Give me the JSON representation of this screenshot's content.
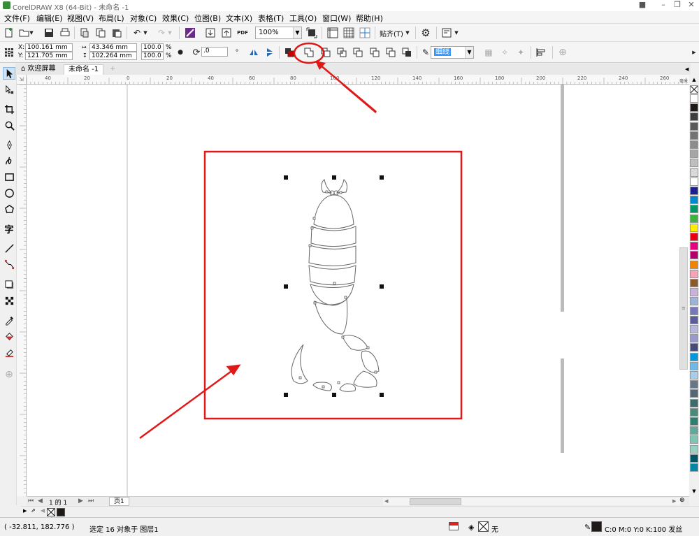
{
  "window": {
    "title": "CorelDRAW X8 (64-Bit) - 未命名 -1"
  },
  "menu": [
    "文件(F)",
    "编辑(E)",
    "视图(V)",
    "布局(L)",
    "对象(C)",
    "效果(C)",
    "位图(B)",
    "文本(X)",
    "表格(T)",
    "工具(O)",
    "窗口(W)",
    "帮助(H)"
  ],
  "toolbar": {
    "zoom": "100%",
    "snap_label": "贴齐(T)",
    "pdf_label": "PDF"
  },
  "properties": {
    "x": "100.161 mm",
    "y": "121.705 mm",
    "x_label": "X:",
    "y_label": "Y:",
    "width": "43.346 mm",
    "height": "102.264 mm",
    "scale_w": "100.0",
    "scale_h": "100.0",
    "pct": "%",
    "rotation": ".0",
    "outline": "细线"
  },
  "tabs": {
    "welcome": "欢迎屏幕",
    "document": "未命名 -1"
  },
  "ruler_h": [
    "40",
    "20",
    "0",
    "20",
    "40",
    "60",
    "80",
    "100",
    "120",
    "140",
    "160",
    "180",
    "200",
    "220",
    "240",
    "260"
  ],
  "ruler_unit": "毫米",
  "pages": {
    "current": "1 的 1",
    "page_tab": "页1"
  },
  "status": {
    "coords": "( -32.811, 182.776 )",
    "selection": "选定 16 对象于 图层1",
    "fill_none": "无",
    "outline_info": "C:0 M:0 Y:0 K:100 发丝"
  },
  "palette": [
    "#ffffff",
    "#1f1a17",
    "#3d3d3d",
    "#595959",
    "#737373",
    "#8c8c8c",
    "#a6a6a6",
    "#bfbfbf",
    "#d9d9d9",
    "#ffffff",
    "#1a1f8c",
    "#0088cc",
    "#009966",
    "#3cb33c",
    "#ffee00",
    "#e60012",
    "#e4007f",
    "#b5006a",
    "#f08300",
    "#f4a6b7",
    "#8b5a2b",
    "#c9b1d9",
    "#9cb3d6",
    "#7777bb",
    "#5c5c99",
    "#b7b7dd",
    "#9999cc",
    "#4a4a7a",
    "#0099dd",
    "#6fb8e8",
    "#a9cde8",
    "#667788",
    "#556677",
    "#3b6b6b",
    "#4a8a7a",
    "#2e7d6f",
    "#62a89a",
    "#7fc4b4",
    "#98d0c3",
    "#005566",
    "#0088aa"
  ]
}
